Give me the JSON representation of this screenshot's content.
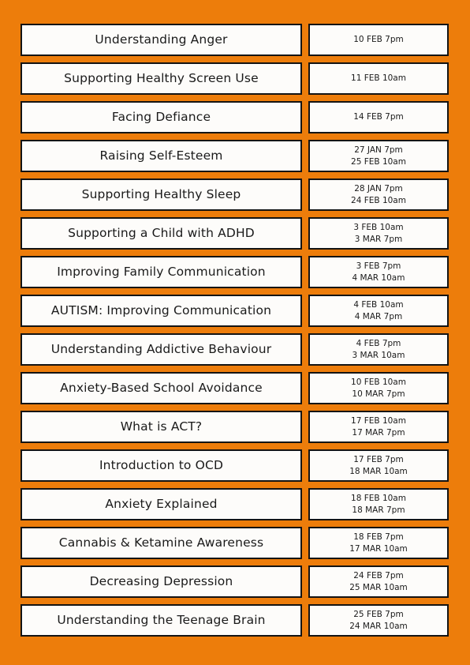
{
  "poster": {
    "background_color": "#ED7D0B",
    "box_fill_color": "#FDFCFA",
    "box_border_color": "#141414",
    "bottom_cutoff_text": ""
  },
  "schedule": {
    "rows": [
      {
        "workshop": "Understanding Anger",
        "dates": [
          "10 FEB 7pm"
        ]
      },
      {
        "workshop": "Supporting Healthy Screen Use",
        "dates": [
          "11 FEB 10am"
        ]
      },
      {
        "workshop": "Facing Defiance",
        "dates": [
          "14 FEB 7pm"
        ]
      },
      {
        "workshop": "Raising Self-Esteem",
        "dates": [
          "27 JAN 7pm",
          "25 FEB 10am"
        ]
      },
      {
        "workshop": "Supporting Healthy Sleep",
        "dates": [
          "28 JAN 7pm",
          "24 FEB 10am"
        ]
      },
      {
        "workshop": "Supporting a Child with ADHD",
        "dates": [
          "3 FEB 10am",
          "3 MAR 7pm"
        ]
      },
      {
        "workshop": "Improving Family Communication",
        "dates": [
          "3 FEB 7pm",
          "4 MAR 10am"
        ]
      },
      {
        "workshop": "AUTISM: Improving Communication",
        "dates": [
          "4 FEB 10am",
          "4 MAR 7pm"
        ]
      },
      {
        "workshop": "Understanding Addictive Behaviour",
        "dates": [
          "4 FEB 7pm",
          "3 MAR 10am"
        ]
      },
      {
        "workshop": "Anxiety-Based School Avoidance",
        "dates": [
          "10 FEB 10am",
          "10 MAR 7pm"
        ]
      },
      {
        "workshop": "What is ACT?",
        "dates": [
          "17 FEB 10am",
          "17 MAR 7pm"
        ]
      },
      {
        "workshop": "Introduction to OCD",
        "dates": [
          "17 FEB 7pm",
          "18 MAR 10am"
        ]
      },
      {
        "workshop": "Anxiety Explained",
        "dates": [
          "18 FEB 10am",
          "18 MAR 7pm"
        ]
      },
      {
        "workshop": "Cannabis & Ketamine Awareness",
        "dates": [
          "18 FEB 7pm",
          "17 MAR 10am"
        ]
      },
      {
        "workshop": "Decreasing Depression",
        "dates": [
          "24 FEB 7pm",
          "25 MAR 10am"
        ]
      },
      {
        "workshop": "Understanding the Teenage Brain",
        "dates": [
          "25 FEB 7pm",
          "24 MAR 10am"
        ]
      }
    ]
  }
}
